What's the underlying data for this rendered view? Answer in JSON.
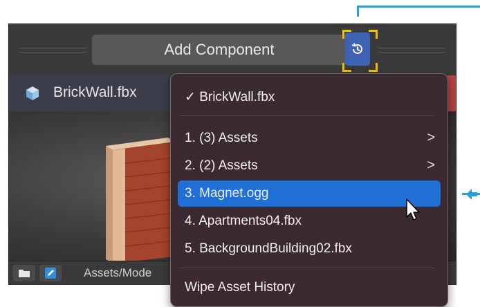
{
  "toolbar": {
    "add_component_label": "Add Component"
  },
  "asset": {
    "name": "BrickWall.fbx"
  },
  "bottom_bar": {
    "path": "Assets/Mode"
  },
  "menu": {
    "current": "✓ BrickWall.fbx",
    "items": [
      {
        "label": "1. (3) Assets",
        "submenu": true
      },
      {
        "label": "2. (2) Assets",
        "submenu": true
      },
      {
        "label": "3. Magnet.ogg",
        "submenu": false,
        "highlighted": true
      },
      {
        "label": "4. Apartments04.fbx",
        "submenu": false
      },
      {
        "label": "5. BackgroundBuilding02.fbx",
        "submenu": false
      }
    ],
    "wipe_label": "Wipe Asset History",
    "chevron": ">"
  },
  "colors": {
    "accent": "#1f6fd6",
    "history_button": "#3e63b5",
    "highlight_corners": "#f2c200",
    "callout": "#2a9fd6"
  },
  "icons": [
    "history-icon",
    "cube-icon",
    "folder-icon",
    "pencil-icon",
    "chevron-right-icon",
    "mouse-cursor-icon"
  ]
}
